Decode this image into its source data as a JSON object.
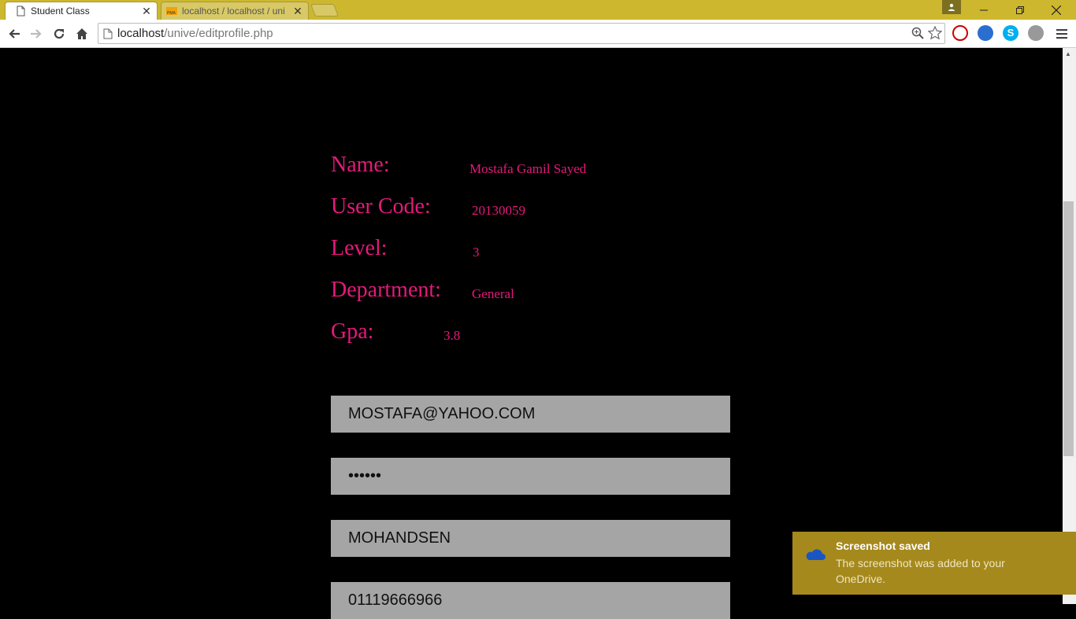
{
  "browser": {
    "tabs": [
      {
        "title": "Student Class",
        "active": true
      },
      {
        "title": "localhost / localhost / uni",
        "active": false
      }
    ],
    "url_host": "localhost",
    "url_path": "/unive/editprofile.php"
  },
  "profile": {
    "name_label": "Name:",
    "name_value": "Mostafa Gamil Sayed",
    "code_label": "User Code:",
    "code_value": "20130059",
    "level_label": "Level:",
    "level_value": "3",
    "department_label": "Department:",
    "department_value": "General",
    "gpa_label": "Gpa:",
    "gpa_value": "3.8"
  },
  "form": {
    "email": "MOSTAFA@YAHOO.COM",
    "password": "••••••",
    "username": "MOHANDSEN",
    "phone": "01119666966"
  },
  "toast": {
    "title": "Screenshot saved",
    "body": "The screenshot was added to your OneDrive."
  },
  "colors": {
    "accent": "#e5197b",
    "tabbar": "#cdb72e",
    "input_bg": "#a5a5a5",
    "toast_bg": "#a5891d"
  }
}
